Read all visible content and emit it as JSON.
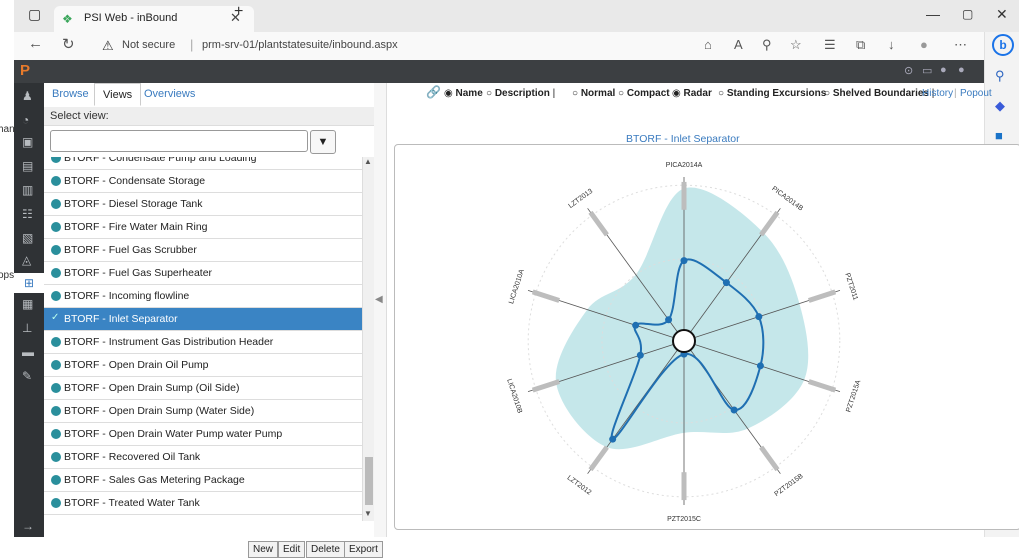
{
  "background_app": {
    "fragments": [
      "hanc",
      "ops"
    ]
  },
  "browser": {
    "tab_title": "PSI Web - inBound",
    "url_warning": "Not secure",
    "url": "prm-srv-01/plantstatesuite/inbound.aspx",
    "edge_sidebar_icons": [
      "bing-icon",
      "search-icon",
      "copilot-icon",
      "outlook-icon",
      "add-icon",
      "sidebar-toggle-icon",
      "settings-icon"
    ]
  },
  "app": {
    "logo": "P",
    "tabs": {
      "browse": "Browse",
      "views": "Views",
      "overviews": "Overviews"
    },
    "select_view_label": "Select view:",
    "filter_placeholder": "",
    "views": [
      "BTORF - Condensate Pump and Loading",
      "BTORF - Condensate Storage",
      "BTORF - Diesel Storage Tank",
      "BTORF - Fire Water Main Ring",
      "BTORF - Fuel Gas Scrubber",
      "BTORF - Fuel Gas Superheater",
      "BTORF - Incoming flowline",
      "BTORF - Inlet Separator",
      "BTORF - Instrument Gas Distribution Header",
      "BTORF - Open Drain Oil Pump",
      "BTORF - Open Drain Sump (Oil Side)",
      "BTORF - Open Drain Sump (Water Side)",
      "BTORF - Open Drain Water Pump water Pump",
      "BTORF - Recovered Oil Tank",
      "BTORF - Sales Gas Metering Package",
      "BTORF - Treated Water Tank"
    ],
    "selected_view": "BTORF - Inlet Separator",
    "footer_buttons": {
      "new": "New",
      "edit": "Edit",
      "delete": "Delete",
      "export": "Export"
    },
    "toolbar": {
      "name": "Name",
      "description": "Description",
      "normal": "Normal",
      "compact": "Compact",
      "radar": "Radar",
      "standing": "Standing Excursions",
      "shelved": "Shelved Boundaries",
      "history": "History",
      "popout": "Popout",
      "selected_label_mode": "Name",
      "selected_display_mode": "Radar",
      "separator": "|"
    }
  },
  "chart_data": {
    "type": "radar",
    "title": "BTORF - Inlet Separator",
    "axes": [
      "PICA2014A",
      "PICA2014B",
      "PZT2011",
      "PZT2015A",
      "PZT2015B",
      "PZT2015C",
      "LZT2012",
      "LICA2010B",
      "LICA2010A",
      "LZT2013"
    ],
    "values": [
      0.49,
      0.44,
      0.48,
      0.49,
      0.52,
      0.08,
      0.74,
      0.28,
      0.31,
      0.16
    ],
    "envelope": [
      0.93,
      0.82,
      0.74,
      0.77,
      0.66,
      0.56,
      0.8,
      0.82,
      0.62,
      0.5
    ],
    "colors": {
      "series": "#1f6fb2",
      "envelope": "#c5e7ea",
      "axis": "#555555",
      "marker": "#bdbdbd"
    }
  }
}
